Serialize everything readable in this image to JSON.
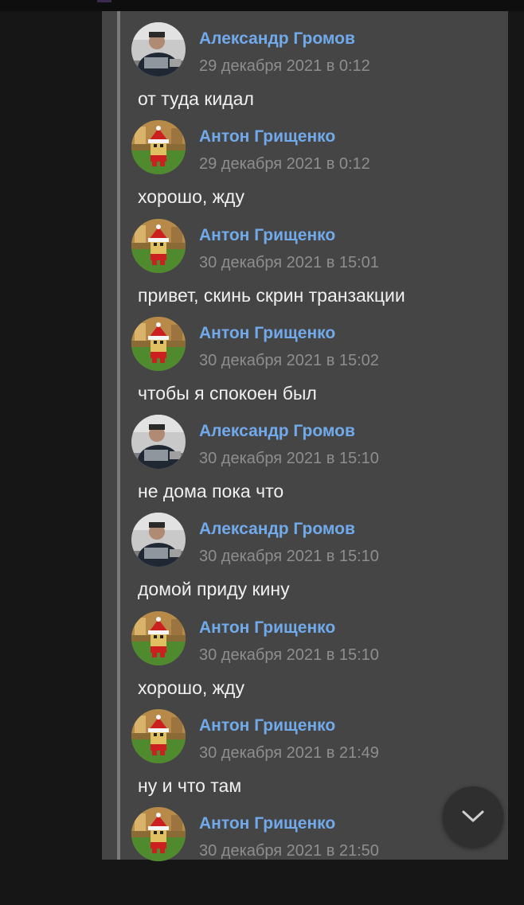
{
  "messages": [
    {
      "author": "Александр Громов",
      "date": "29 декабря 2021 в 0:12",
      "text": "от туда кидал",
      "avatar": "alexander"
    },
    {
      "author": "Антон Грищенко",
      "date": "29 декабря 2021 в 0:12",
      "text": "хорошо, жду",
      "avatar": "anton"
    },
    {
      "author": "Антон Грищенко",
      "date": "30 декабря 2021 в 15:01",
      "text": "привет, скинь скрин транзакции",
      "avatar": "anton"
    },
    {
      "author": "Антон Грищенко",
      "date": "30 декабря 2021 в 15:02",
      "text": "чтобы я спокоен был",
      "avatar": "anton"
    },
    {
      "author": "Александр Громов",
      "date": "30 декабря 2021 в 15:10",
      "text": "не дома пока что",
      "avatar": "alexander"
    },
    {
      "author": "Александр Громов",
      "date": "30 декабря 2021 в 15:10",
      "text": "домой приду кину",
      "avatar": "alexander"
    },
    {
      "author": "Антон Грищенко",
      "date": "30 декабря 2021 в 15:10",
      "text": "хорошо, жду",
      "avatar": "anton"
    },
    {
      "author": "Антон Грищенко",
      "date": "30 декабря 2021 в 21:49",
      "text": "ну и что там",
      "avatar": "anton"
    },
    {
      "author": "Антон Грищенко",
      "date": "30 декабря 2021 в 21:50",
      "text": "",
      "avatar": "anton"
    }
  ],
  "scroll_button": {
    "icon": "chevron-down-icon"
  },
  "colors": {
    "background": "#161616",
    "panel": "#454545",
    "author": "#71aaeb",
    "date": "#8e8e8e",
    "text": "#f0f0f0"
  }
}
